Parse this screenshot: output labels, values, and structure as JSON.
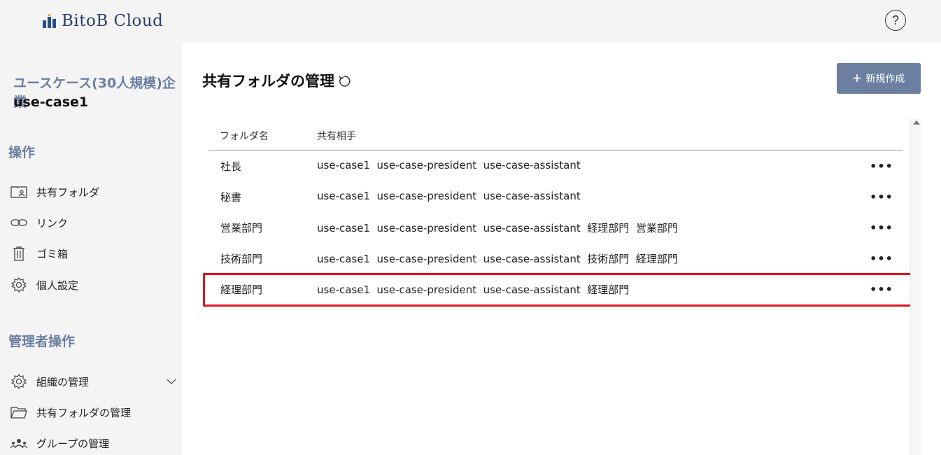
{
  "header": {
    "logo_text": "BitoB Cloud",
    "help_label": "?"
  },
  "sidebar": {
    "org_name": "ユースケース(30人規模)企業",
    "org_id": "use-case1",
    "ops_title": "操作",
    "ops_items": [
      {
        "label": "共有フォルダ",
        "icon": "shared-folder-icon"
      },
      {
        "label": "リンク",
        "icon": "link-icon"
      },
      {
        "label": "ゴミ箱",
        "icon": "trash-icon"
      },
      {
        "label": "個人設定",
        "icon": "gear-icon"
      }
    ],
    "admin_title": "管理者操作",
    "admin_items": [
      {
        "label": "組織の管理",
        "icon": "gear-icon"
      },
      {
        "label": "共有フォルダの管理",
        "icon": "folder-open-icon"
      },
      {
        "label": "グループの管理",
        "icon": "group-icon"
      }
    ]
  },
  "main": {
    "title": "共有フォルダの管理",
    "new_button_label": "新規作成",
    "columns": [
      "フォルダ名",
      "共有相手"
    ],
    "rows": [
      {
        "name": "社長",
        "shared": "use-case1  use-case-president  use-case-assistant"
      },
      {
        "name": "秘書",
        "shared": "use-case1  use-case-president  use-case-assistant"
      },
      {
        "name": "営業部門",
        "shared": "use-case1  use-case-president  use-case-assistant  経理部門  営業部門"
      },
      {
        "name": "技術部門",
        "shared": "use-case1  use-case-president  use-case-assistant  技術部門  経理部門"
      },
      {
        "name": "経理部門",
        "shared": "use-case1  use-case-president  use-case-assistant  経理部門"
      }
    ],
    "more_label": "•••"
  },
  "colors": {
    "accent": "#6b7fa0",
    "highlight": "#e0141e",
    "heading": "#6a7fa3"
  }
}
